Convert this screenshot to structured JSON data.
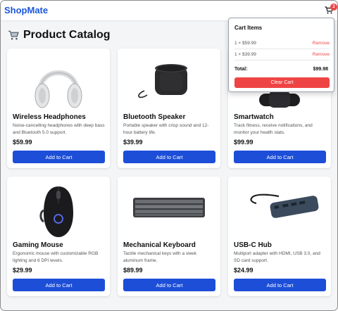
{
  "app": {
    "brand": "ShopMate"
  },
  "header": {
    "cart_icon": "shopping-cart-icon",
    "cart_count": "2"
  },
  "catalog": {
    "title": "Product Catalog",
    "title_icon": "shopping-cart-icon"
  },
  "products": [
    {
      "name": "Wireless Headphones",
      "description": "Noise-cancelling headphones with deep bass and Bluetooth 5.0 support.",
      "price": "$59.99",
      "button": "Add to Cart",
      "image": "headphones"
    },
    {
      "name": "Bluetooth Speaker",
      "description": "Portable speaker with crisp sound and 12-hour battery life.",
      "price": "$39.99",
      "button": "Add to Cart",
      "image": "speaker"
    },
    {
      "name": "Smartwatch",
      "description": "Track fitness, receive notifications, and monitor your health stats.",
      "price": "$99.99",
      "button": "Add to Cart",
      "image": "smartwatch"
    },
    {
      "name": "Gaming Mouse",
      "description": "Ergonomic mouse with customizable RGB lighting and 6 DPI levels.",
      "price": "$29.99",
      "button": "Add to Cart",
      "image": "mouse"
    },
    {
      "name": "Mechanical Keyboard",
      "description": "Tactile mechanical keys with a sleek aluminum frame.",
      "price": "$89.99",
      "button": "Add to Cart",
      "image": "keyboard"
    },
    {
      "name": "USB-C Hub",
      "description": "Multiport adapter with HDMI, USB 3.0, and SD card support.",
      "price": "$24.99",
      "button": "Add to Cart",
      "image": "usb-hub"
    }
  ],
  "cart": {
    "title": "Cart Items",
    "items": [
      {
        "text": "1 × $59.99",
        "remove": "Remove"
      },
      {
        "text": "1 × $39.99",
        "remove": "Remove"
      }
    ],
    "total_label": "Total:",
    "total_value": "$99.98",
    "clear_label": "Clear Cart"
  },
  "colors": {
    "brand": "#1a56db",
    "primary_button": "#1d4ed8",
    "danger": "#ef4444"
  }
}
